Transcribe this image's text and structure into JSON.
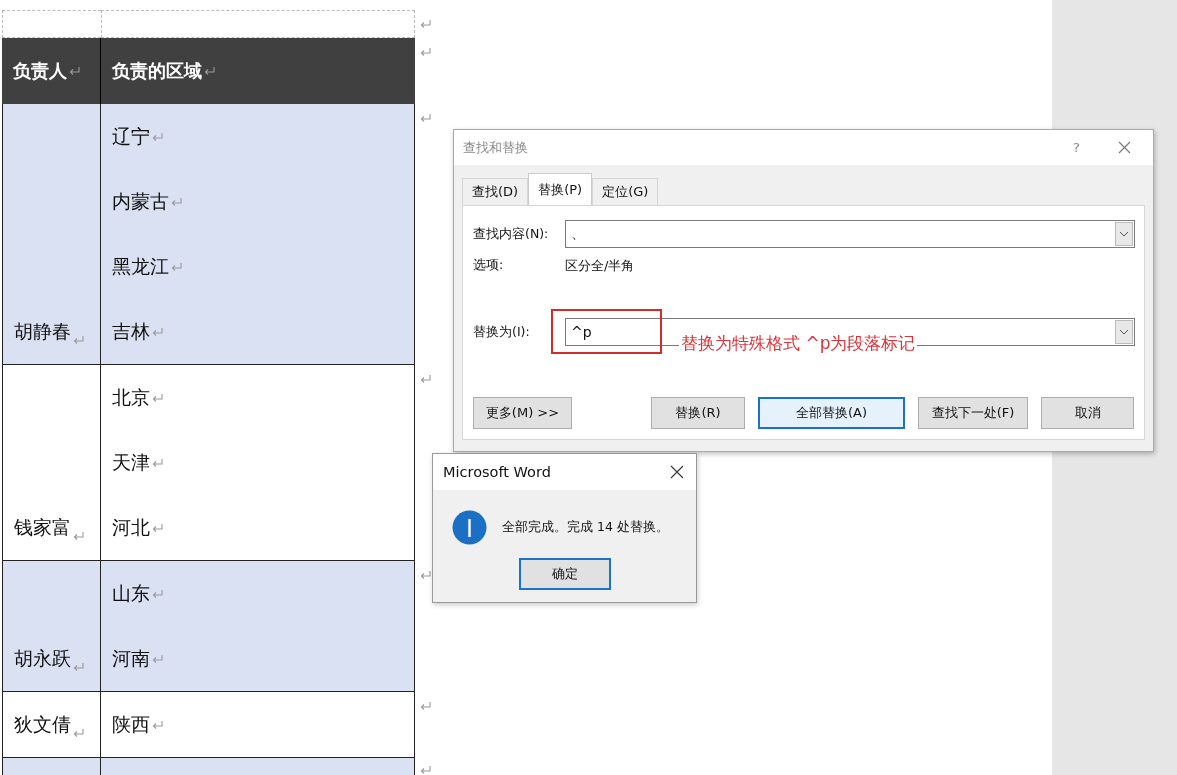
{
  "table": {
    "columns": [
      "负责人",
      "负责的区域"
    ],
    "groups": [
      {
        "owner": "胡静春",
        "shaded": true,
        "regions": [
          "辽宁",
          "内蒙古",
          "黑龙江",
          "吉林"
        ]
      },
      {
        "owner": "钱家富",
        "shaded": false,
        "regions": [
          "北京",
          "天津",
          "河北"
        ]
      },
      {
        "owner": "胡永跃",
        "shaded": true,
        "regions": [
          "山东",
          "河南"
        ]
      },
      {
        "owner": "狄文倩",
        "shaded": false,
        "regions": [
          "陕西"
        ]
      },
      {
        "shaded": true
      }
    ]
  },
  "find_replace": {
    "title": "查找和替换",
    "help": "?",
    "tabs": [
      {
        "label": "查找(D)",
        "selected": false
      },
      {
        "label": "替换(P)",
        "selected": true
      },
      {
        "label": "定位(G)",
        "selected": false
      }
    ],
    "find_what": {
      "label": "查找内容(N):",
      "value": "、"
    },
    "options": {
      "label": "选项:",
      "value": "区分全/半角"
    },
    "replace_with": {
      "label": "替换为(I):",
      "value": "^p",
      "highlighted": true
    },
    "annotation": "替换为特殊格式 ^p为段落标记",
    "buttons": [
      {
        "label": "更多(M) >>",
        "default": false
      },
      {
        "label": "替换(R)",
        "default": false
      },
      {
        "label": "全部替换(A)",
        "default": true
      },
      {
        "label": "查找下一处(F)",
        "default": false
      },
      {
        "label": "取消",
        "default": false
      }
    ]
  },
  "message_box": {
    "title": "Microsoft Word",
    "message": "全部完成。完成 14 处替换。",
    "button": "确定"
  }
}
